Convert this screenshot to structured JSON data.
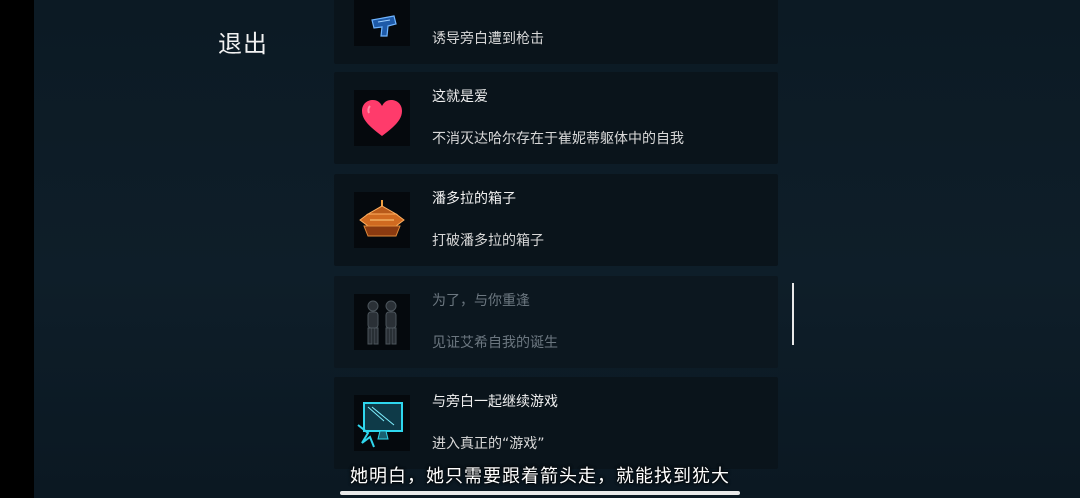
{
  "header": {
    "exit_label": "退出"
  },
  "achievements": [
    {
      "title": "",
      "desc": "诱导旁白遭到枪击",
      "icon": "gun-icon",
      "locked": false
    },
    {
      "title": "这就是爱",
      "desc": "不消灭达哈尔存在于崔妮蒂躯体中的自我",
      "icon": "heart-icon",
      "locked": false,
      "icon_color": "#ff3b6b"
    },
    {
      "title": "潘多拉的箱子",
      "desc": "打破潘多拉的箱子",
      "icon": "pandora-box-icon",
      "locked": false,
      "icon_color": "#e0782a"
    },
    {
      "title": "为了，与你重逢",
      "desc": "见证艾希自我的诞生",
      "icon": "two-figures-icon",
      "locked": true
    },
    {
      "title": "与旁白一起继续游戏",
      "desc": "进入真正的“游戏”",
      "icon": "monitor-icon",
      "locked": false,
      "icon_color": "#2fd7ee"
    }
  ],
  "subtitle": "她明白，她只需要跟着箭头走，就能找到犹大",
  "colors": {
    "background": "#0e1e29",
    "card": "#0a141b",
    "text": "#f0f0f0",
    "locked_text": "#6c7780"
  }
}
